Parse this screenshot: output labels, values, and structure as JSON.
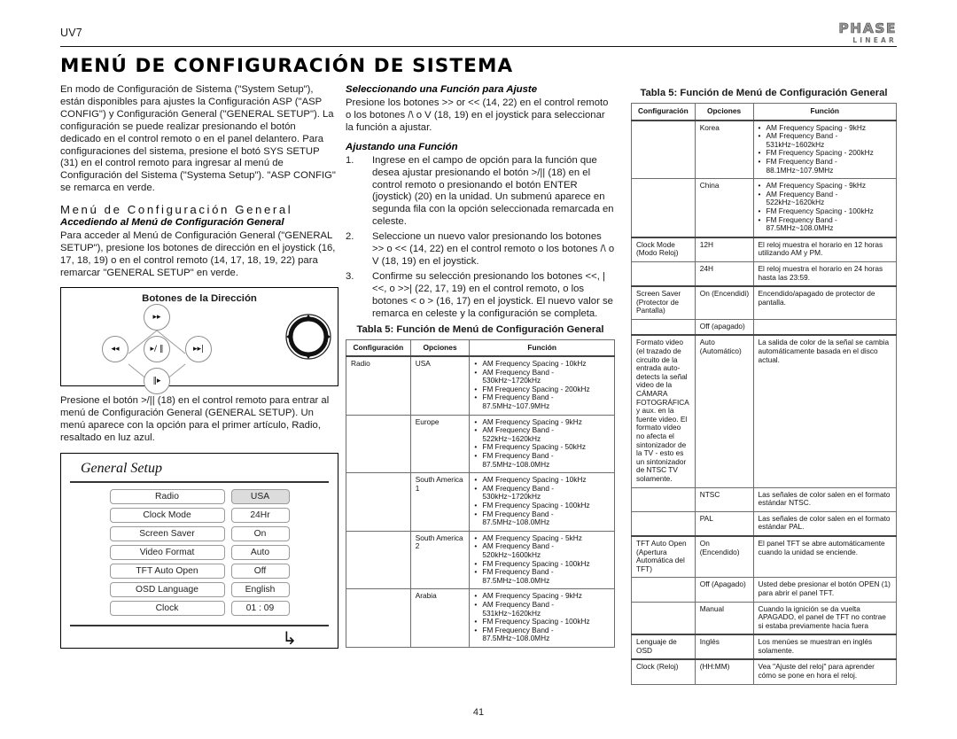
{
  "header": {
    "model": "UV7",
    "logo_main": "PHASE",
    "logo_sub": "LINEAR",
    "page_title": "MENÚ DE CONFIGURACIÓN DE SISTEMA"
  },
  "left": {
    "intro": "En modo de Configuración de Sistema (\"System Setup\"), están disponibles para ajustes la Configuración ASP (\"ASP CONFIG\") y Configuración General (\"GENERAL SETUP\"). La configuración se puede realizar presionando el botón dedicado en el control remoto o en el panel delantero. Para configuraciones del sistema, presione el botó SYS SETUP (31) en el control remoto para ingresar al menú de Configuración del Sistema (\"Systema Setup\"). \"ASP CONFIG\" se remarca en verde.",
    "h2": "Menú de Configuración General",
    "h3": "Accediendo al Menú de Configuración General",
    "para2": "Para acceder al Menú de Configuración General (\"GENERAL SETUP\"), presione los botones de dirección en el joystick (16, 17, 18, 19) o en el control remoto (14, 17, 18, 19, 22) para remarcar \"GENERAL SETUP\" en verde.",
    "fig_dir_caption": "Botones de la Dirección",
    "dpad": {
      "up": "▸▸",
      "left": "◂◂",
      "center": "▸/ ‖",
      "right": "▸▸|",
      "down": "‖▸"
    },
    "para3": "Presione el botón >/|| (18) en el control remoto para entrar al menú de Configuración General (GENERAL SETUP). Un menú aparece con la opción para el primer artículo, Radio, resaltado en luz azul.",
    "general_setup": {
      "title": "General Setup",
      "back_icon": "back-arrow-icon",
      "rows": [
        {
          "name": "Radio",
          "value": "USA",
          "selected": true
        },
        {
          "name": "Clock  Mode",
          "value": "24Hr",
          "selected": false
        },
        {
          "name": "Screen Saver",
          "value": "On",
          "selected": false
        },
        {
          "name": "Video Format",
          "value": "Auto",
          "selected": false
        },
        {
          "name": "TFT Auto Open",
          "value": "Off",
          "selected": false
        },
        {
          "name": "OSD Language",
          "value": "English",
          "selected": false
        },
        {
          "name": "Clock",
          "value": "01 :  09",
          "selected": false
        }
      ]
    }
  },
  "mid": {
    "h3_select": "Seleccionando una Función para Ajuste",
    "para_select": "Presione los botones >> or << (14, 22) en el control remoto o los botones /\\ o V (18, 19) en el joystick para seleccionar la función a ajustar.",
    "h3_adjust": "Ajustando una Función",
    "steps": [
      {
        "num": "1.",
        "text": "Ingrese en el campo de opción para la función que desea ajustar presionando el botón >/|| (18) en el control remoto o presionando el botón ENTER (joystick) (20) en la unidad. Un submenú aparece en segunda fila con la opción seleccionada remarcada en celeste."
      },
      {
        "num": "2.",
        "text": "Seleccione un nuevo valor presionando los botones >> o << (14, 22) en el control remoto o los botones /\\ o V (18, 19) en el joystick."
      },
      {
        "num": "3.",
        "text": "Confirme su selección presionando los botones <<, |<<, o >>| (22, 17, 19) en el control remoto, o los botones < o > (16, 17) en el joystick. El nuevo valor se remarca en celeste y la configuración se completa."
      }
    ],
    "table_caption": "Tabla 5: Función de Menú de Configuración General",
    "table_headers": [
      "Configuración",
      "Opciones",
      "Función"
    ],
    "table_rows": [
      {
        "config": "Radio",
        "option": "USA",
        "functions": [
          "AM Frequency Spacing - 10kHz",
          "AM Frequency Band - 530kHz~1720kHz",
          "FM Frequency Spacing - 200kHz",
          "FM Frequency Band - 87.5MHz~107.9MHz"
        ]
      },
      {
        "config": "",
        "option": "Europe",
        "functions": [
          "AM Frequency Spacing - 9kHz",
          "AM Frequency Band - 522kHz~1620kHz",
          "FM Frequency Spacing - 50kHz",
          "FM Frequency Band - 87.5MHz~108.0MHz"
        ]
      },
      {
        "config": "",
        "option": "South America 1",
        "functions": [
          "AM Frequency Spacing - 10kHz",
          "AM Frequency Band - 530kHz~1720kHz",
          "FM Frequency Spacing - 100kHz",
          "FM Frequency Band - 87.5MHz~108.0MHz"
        ]
      },
      {
        "config": "",
        "option": "South America 2",
        "functions": [
          "AM Frequency Spacing - 5kHz",
          "AM Frequency Band - 520kHz~1600kHz",
          "FM Frequency Spacing - 100kHz",
          "FM Frequency Band - 87.5MHz~108.0MHz"
        ]
      },
      {
        "config": "",
        "option": "Arabia",
        "functions": [
          "AM Frequency Spacing - 9kHz",
          "AM Frequency Band - 531kHz~1620kHz",
          "FM Frequency Spacing - 100kHz",
          "FM Frequency Band - 87.5MHz~108.0MHz"
        ]
      }
    ]
  },
  "right": {
    "table_caption": "Tabla 5: Función de Menú de Configuración General",
    "table_headers": [
      "Configuración",
      "Opciones",
      "Función"
    ],
    "table_rows": [
      {
        "config": "",
        "option": "Korea",
        "functions": [
          "AM Frequency Spacing - 9kHz",
          "AM Frequency Band - 531kHz~1602kHz",
          "FM Frequency Spacing - 200kHz",
          "FM Frequency Band - 88.1MHz~107.9MHz"
        ]
      },
      {
        "config": "",
        "option": "China",
        "functions": [
          "AM Frequency Spacing - 9kHz",
          "AM Frequency Band - 522kHz~1620kHz",
          "FM Frequency Spacing - 100kHz",
          "FM Frequency Band - 87.5MHz~108.0MHz"
        ]
      },
      {
        "config": "Clock Mode (Modo Reloj)",
        "option": "12H",
        "desc": "El reloj muestra el horario en 12 horas utilizando AM y PM.",
        "thick": true
      },
      {
        "config": "",
        "option": "24H",
        "desc": "El reloj muestra el horario en 24 horas hasta las 23:59."
      },
      {
        "config": "Screen Saver (Protector de Pantalla)",
        "option": "On (Encendidi)",
        "desc": "Encendido/apagado de protector de pantalla.",
        "thick": true
      },
      {
        "config": "",
        "option": "Off (apagado)",
        "desc": ""
      },
      {
        "config": "Formato video (el trazado de circuito de la entrada auto-detects la señal video de la CÁMARA FOTOGRÁFICA y aux. en la fuente video. El formato video no afecta el sintonizador de la TV - esto es un sintonizador de NTSC TV solamente.",
        "option": "Auto (Automático)",
        "desc": "La salida de color de la señal se cambia automáticamente basada en el disco actual.",
        "thick": true
      },
      {
        "config": "",
        "option": "NTSC",
        "desc": "Las señales de color salen en el formato estándar NTSC."
      },
      {
        "config": "",
        "option": "PAL",
        "desc": "Las señales de color salen en el formato estándar PAL."
      },
      {
        "config": "TFT Auto Open (Apertura Automática del TFT)",
        "option": "On (Encendido)",
        "desc": "El panel TFT se abre automáticamente cuando la unidad se enciende.",
        "thick": true
      },
      {
        "config": "",
        "option": "Off (Apagado)",
        "desc": "Usted debe presionar el botón OPEN (1) para abrir el panel TFT."
      },
      {
        "config": "",
        "option": "Manual",
        "desc": "Cuando la ignición se da vuelta APAGADO, el panel de TFT no contrae si estaba previamente hacia fuera"
      },
      {
        "config": "Lenguaje de OSD",
        "option": "Inglés",
        "desc": "Los menúes se muestran en inglés solamente.",
        "thick": true
      },
      {
        "config": "Clock (Reloj)",
        "option": "(HH:MM)",
        "desc": "Vea \"Ajuste del reloj\" para aprender cómo se pone en hora el reloj.",
        "thick": true
      }
    ]
  },
  "footer": {
    "page_number": "41"
  }
}
